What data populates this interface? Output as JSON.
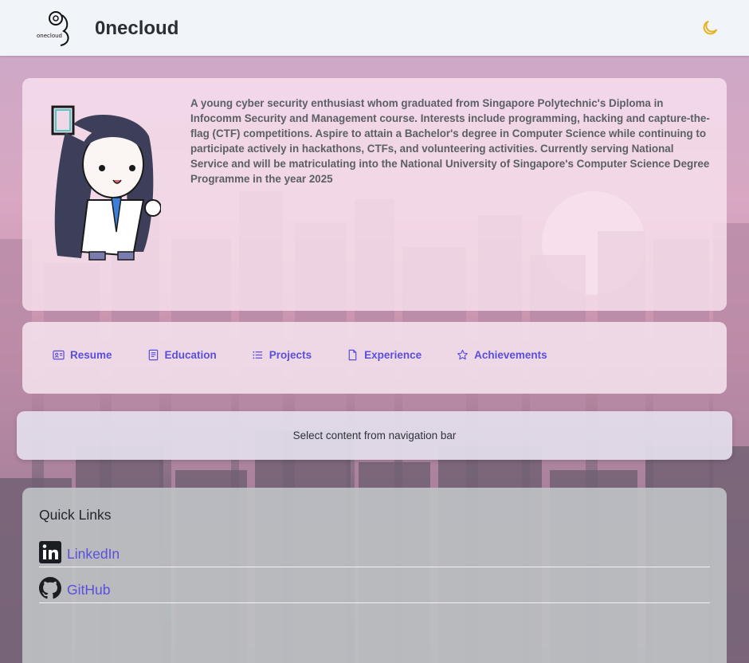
{
  "header": {
    "logo_text": "onecloud",
    "brand_name": "0necloud",
    "theme_icon": "moon-icon",
    "accent_color": "#e8b31c"
  },
  "profile": {
    "bio": "A young cyber security enthusiast whom graduated from Singapore Polytechnic's Diploma in Infocomm Security and Management course. Interests include programming, hacking and capture-the-flag (CTF) competitions. Aspire to attain a Bachelor's degree in Computer Science while continuing to participate actively in hackathons, CTFs, and volunteering activities. Currently serving National Service and will be matriculating into the National University of Singapore's Computer Science Degree Programme in the year 2025"
  },
  "nav": {
    "items": [
      {
        "label": "Resume",
        "icon": "id-card-icon"
      },
      {
        "label": "Education",
        "icon": "book-icon"
      },
      {
        "label": "Projects",
        "icon": "list-icon"
      },
      {
        "label": "Experience",
        "icon": "document-icon"
      },
      {
        "label": "Achievements",
        "icon": "star-icon"
      }
    ],
    "link_color": "#5a4fdc"
  },
  "content": {
    "placeholder": "Select content from navigation bar"
  },
  "quick_links": {
    "title": "Quick Links",
    "links": [
      {
        "label": "LinkedIn",
        "icon": "linkedin-icon"
      },
      {
        "label": "GitHub",
        "icon": "github-icon"
      }
    ]
  }
}
